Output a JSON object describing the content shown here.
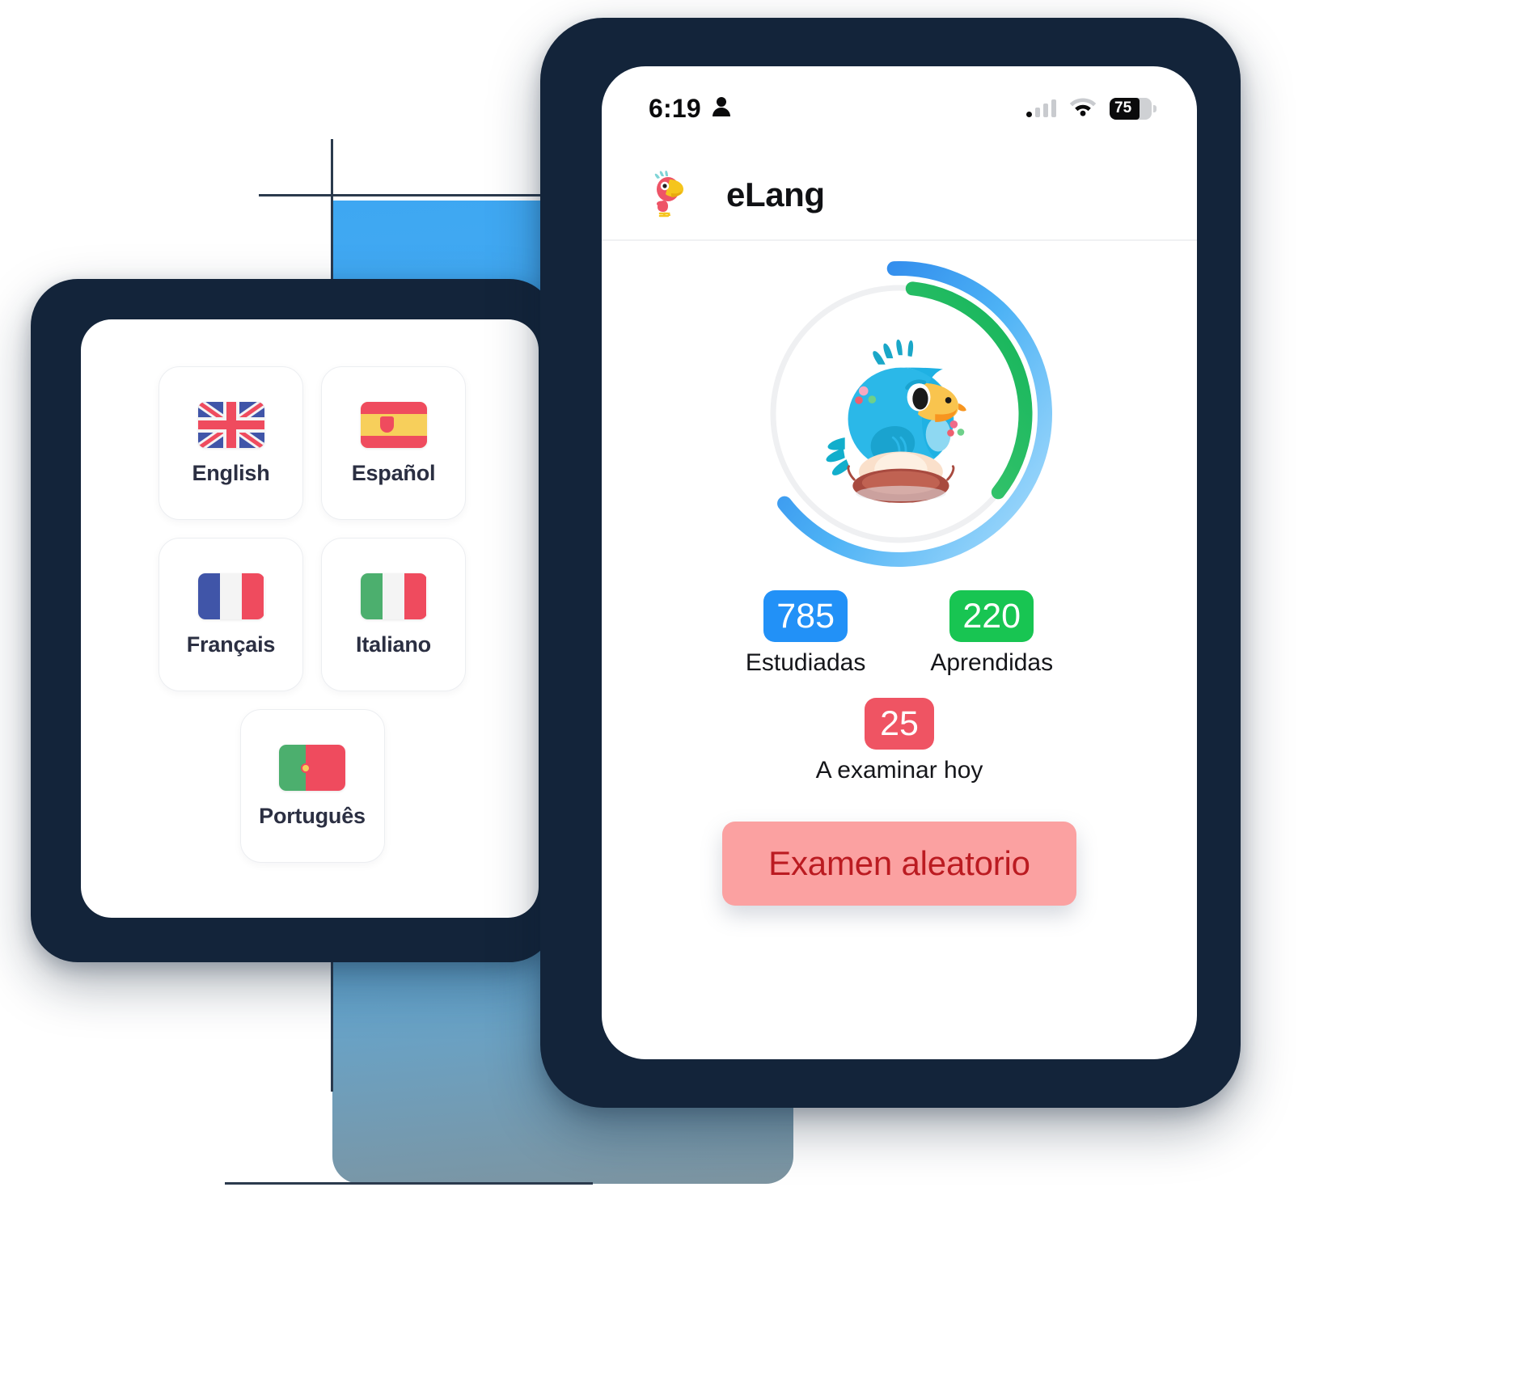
{
  "background": {
    "accent_blue": "#4cb0f5",
    "crosshair_color": "#2b3a4d"
  },
  "left_phone": {
    "name": "language-selection-screen",
    "languages": [
      {
        "label": "English",
        "flag": "flag-gb-icon"
      },
      {
        "label": "Español",
        "flag": "flag-es-icon"
      },
      {
        "label": "Français",
        "flag": "flag-fr-icon"
      },
      {
        "label": "Italiano",
        "flag": "flag-it-icon"
      },
      {
        "label": "Português",
        "flag": "flag-pt-icon"
      }
    ]
  },
  "right_phone": {
    "status_bar": {
      "time": "6:19",
      "person_icon": "person-icon",
      "signal_icon": "cellular-signal-icon",
      "wifi_icon": "wifi-icon",
      "battery_icon": "battery-icon",
      "battery_percent": "75"
    },
    "header": {
      "logo_icon": "parrot-logo-icon",
      "title": "eLang"
    },
    "progress_ring": {
      "outer_arc_color": "#2f9cf4",
      "inner_arc_color": "#2fbf62",
      "track_color": "#f0f1f3",
      "mascot_icon": "blue-parrot-mascot-icon"
    },
    "stats": [
      {
        "value": "785",
        "caption": "Estudiadas",
        "color": "#2291f7"
      },
      {
        "value": "220",
        "caption": "Aprendidas",
        "color": "#18c552"
      },
      {
        "value": "25",
        "caption": "A examinar hoy",
        "color": "#ef5463"
      }
    ],
    "cta": {
      "label": "Examen aleatorio",
      "background": "#fba1a1",
      "text_color": "#bb1b21"
    }
  }
}
